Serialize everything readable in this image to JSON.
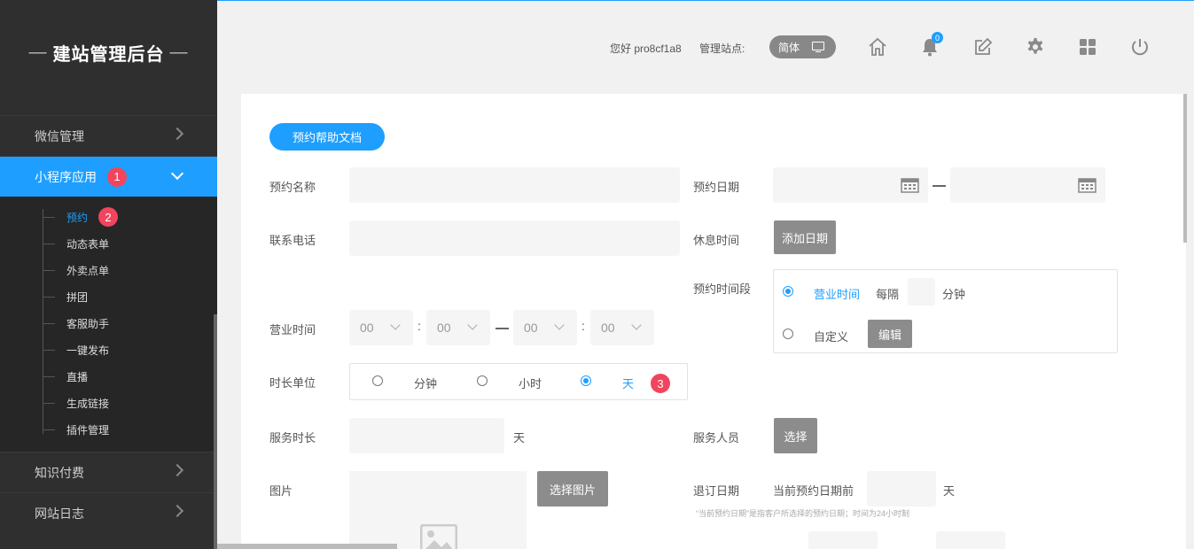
{
  "sidebar": {
    "title": "建站管理后台",
    "title_dash": "—",
    "menu": [
      {
        "label": "微信管理"
      },
      {
        "label": "小程序应用",
        "badge": "1"
      },
      {
        "label": "知识付费"
      },
      {
        "label": "网站日志"
      }
    ],
    "submenu": [
      {
        "label": "预约",
        "badge": "2"
      },
      {
        "label": "动态表单"
      },
      {
        "label": "外卖点单"
      },
      {
        "label": "拼团"
      },
      {
        "label": "客服助手"
      },
      {
        "label": "一键发布"
      },
      {
        "label": "直播"
      },
      {
        "label": "生成链接"
      },
      {
        "label": "插件管理"
      }
    ]
  },
  "header": {
    "greeting": "您好 pro8cf1a8",
    "site_label": "管理站点:",
    "lang": "简体",
    "bell_count": "0",
    "icons": [
      "home-icon",
      "bell-icon",
      "edit-icon",
      "gear-icon",
      "grid-icon",
      "power-icon"
    ]
  },
  "form": {
    "help_button": "预约帮助文档",
    "name_label": "预约名称",
    "date_label": "预约日期",
    "phone_label": "联系电话",
    "rest_label": "休息时间",
    "add_date_button": "添加日期",
    "period_label": "预约时间段",
    "business_hours_option": "营业时间",
    "every_label": "每隔",
    "minute_unit": "分钟",
    "custom_option": "自定义",
    "edit_button": "编辑",
    "business_time_label": "营业时间",
    "time_values": [
      "00",
      "00",
      "00",
      "00"
    ],
    "duration_unit_label": "时长单位",
    "unit_options": [
      "分钟",
      "小时",
      "天"
    ],
    "unit_selected": "天",
    "unit_badge": "3",
    "service_duration_label": "服务时长",
    "day_unit": "天",
    "staff_label": "服务人员",
    "select_button": "选择",
    "image_label": "图片",
    "select_image_button": "选择图片",
    "refund_label": "退订日期",
    "refund_before_label": "当前预约日期前",
    "refund_day_unit": "天",
    "refund_note": "“当前预约日期”是指客户所选择的预约日期；时间为24小时制"
  }
}
